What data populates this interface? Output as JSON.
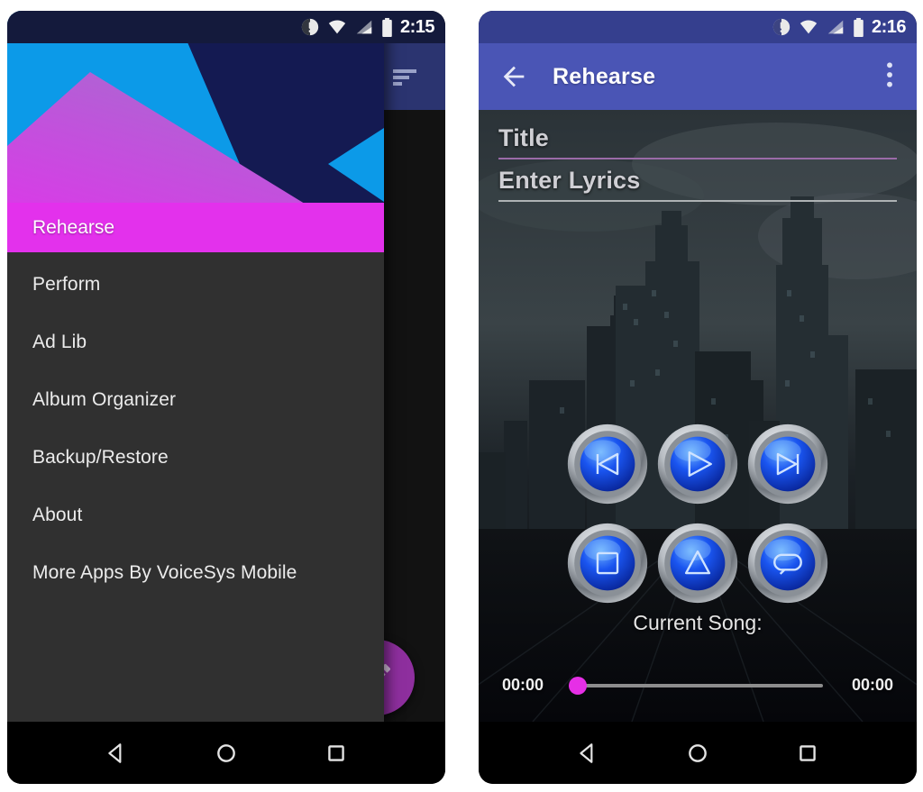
{
  "colors": {
    "accent_magenta": "#e331ec",
    "drawer_bg": "#303030",
    "appbar_blue": "#4a55b5",
    "statusbar_left": "#141a3c",
    "statusbar_right": "#353f8e",
    "fab_purple": "#8e2f9e",
    "header_cyan": "#0c9ae8",
    "header_navy": "#141a52",
    "header_violet": "#b05fce",
    "title_underline": "#9b6ba8",
    "lyrics_underline": "#aeb2b4",
    "seek_thumb": "#e62fe6"
  },
  "phone_left": {
    "status_bar": {
      "time": "2:15",
      "icons": [
        "notification-dot-icon",
        "wifi-icon",
        "cell-signal-icon",
        "battery-icon"
      ]
    },
    "behind_appbar": {
      "sort_icon": "sort-icon"
    },
    "fab": {
      "icon": "edit-pencil-icon"
    },
    "drawer": {
      "selected_item": {
        "label": "Rehearse",
        "icon": "rehearse-icon"
      },
      "items": [
        {
          "label": "Perform"
        },
        {
          "label": "Ad Lib"
        },
        {
          "label": "Album Organizer"
        },
        {
          "label": "Backup/Restore"
        },
        {
          "label": "About"
        },
        {
          "label": "More Apps By VoiceSys Mobile"
        }
      ]
    },
    "nav_bar": {
      "back": "back-triangle-icon",
      "home": "home-circle-icon",
      "recents": "recents-square-icon"
    }
  },
  "phone_right": {
    "status_bar": {
      "time": "2:16",
      "icons": [
        "notification-dot-icon",
        "wifi-icon",
        "cell-signal-icon",
        "battery-icon"
      ]
    },
    "app_bar": {
      "back_icon": "back-arrow-icon",
      "title": "Rehearse",
      "overflow_icon": "overflow-menu-icon"
    },
    "form": {
      "title_field": {
        "placeholder": "Title",
        "value": ""
      },
      "lyrics_field": {
        "placeholder": "Enter Lyrics",
        "value": ""
      }
    },
    "media_buttons": [
      {
        "name": "previous-button",
        "icon": "skip-previous-icon"
      },
      {
        "name": "play-button",
        "icon": "play-icon"
      },
      {
        "name": "next-button",
        "icon": "skip-next-icon"
      },
      {
        "name": "stop-button",
        "icon": "stop-square-icon"
      },
      {
        "name": "record-button",
        "icon": "triangle-up-icon"
      },
      {
        "name": "loop-button",
        "icon": "loop-repeat-icon"
      }
    ],
    "now_playing": {
      "label": "Current Song:",
      "song": ""
    },
    "seek_bar": {
      "elapsed": "00:00",
      "total": "00:00",
      "progress_percent": 0
    },
    "nav_bar": {
      "back": "back-triangle-icon",
      "home": "home-circle-icon",
      "recents": "recents-square-icon"
    }
  }
}
